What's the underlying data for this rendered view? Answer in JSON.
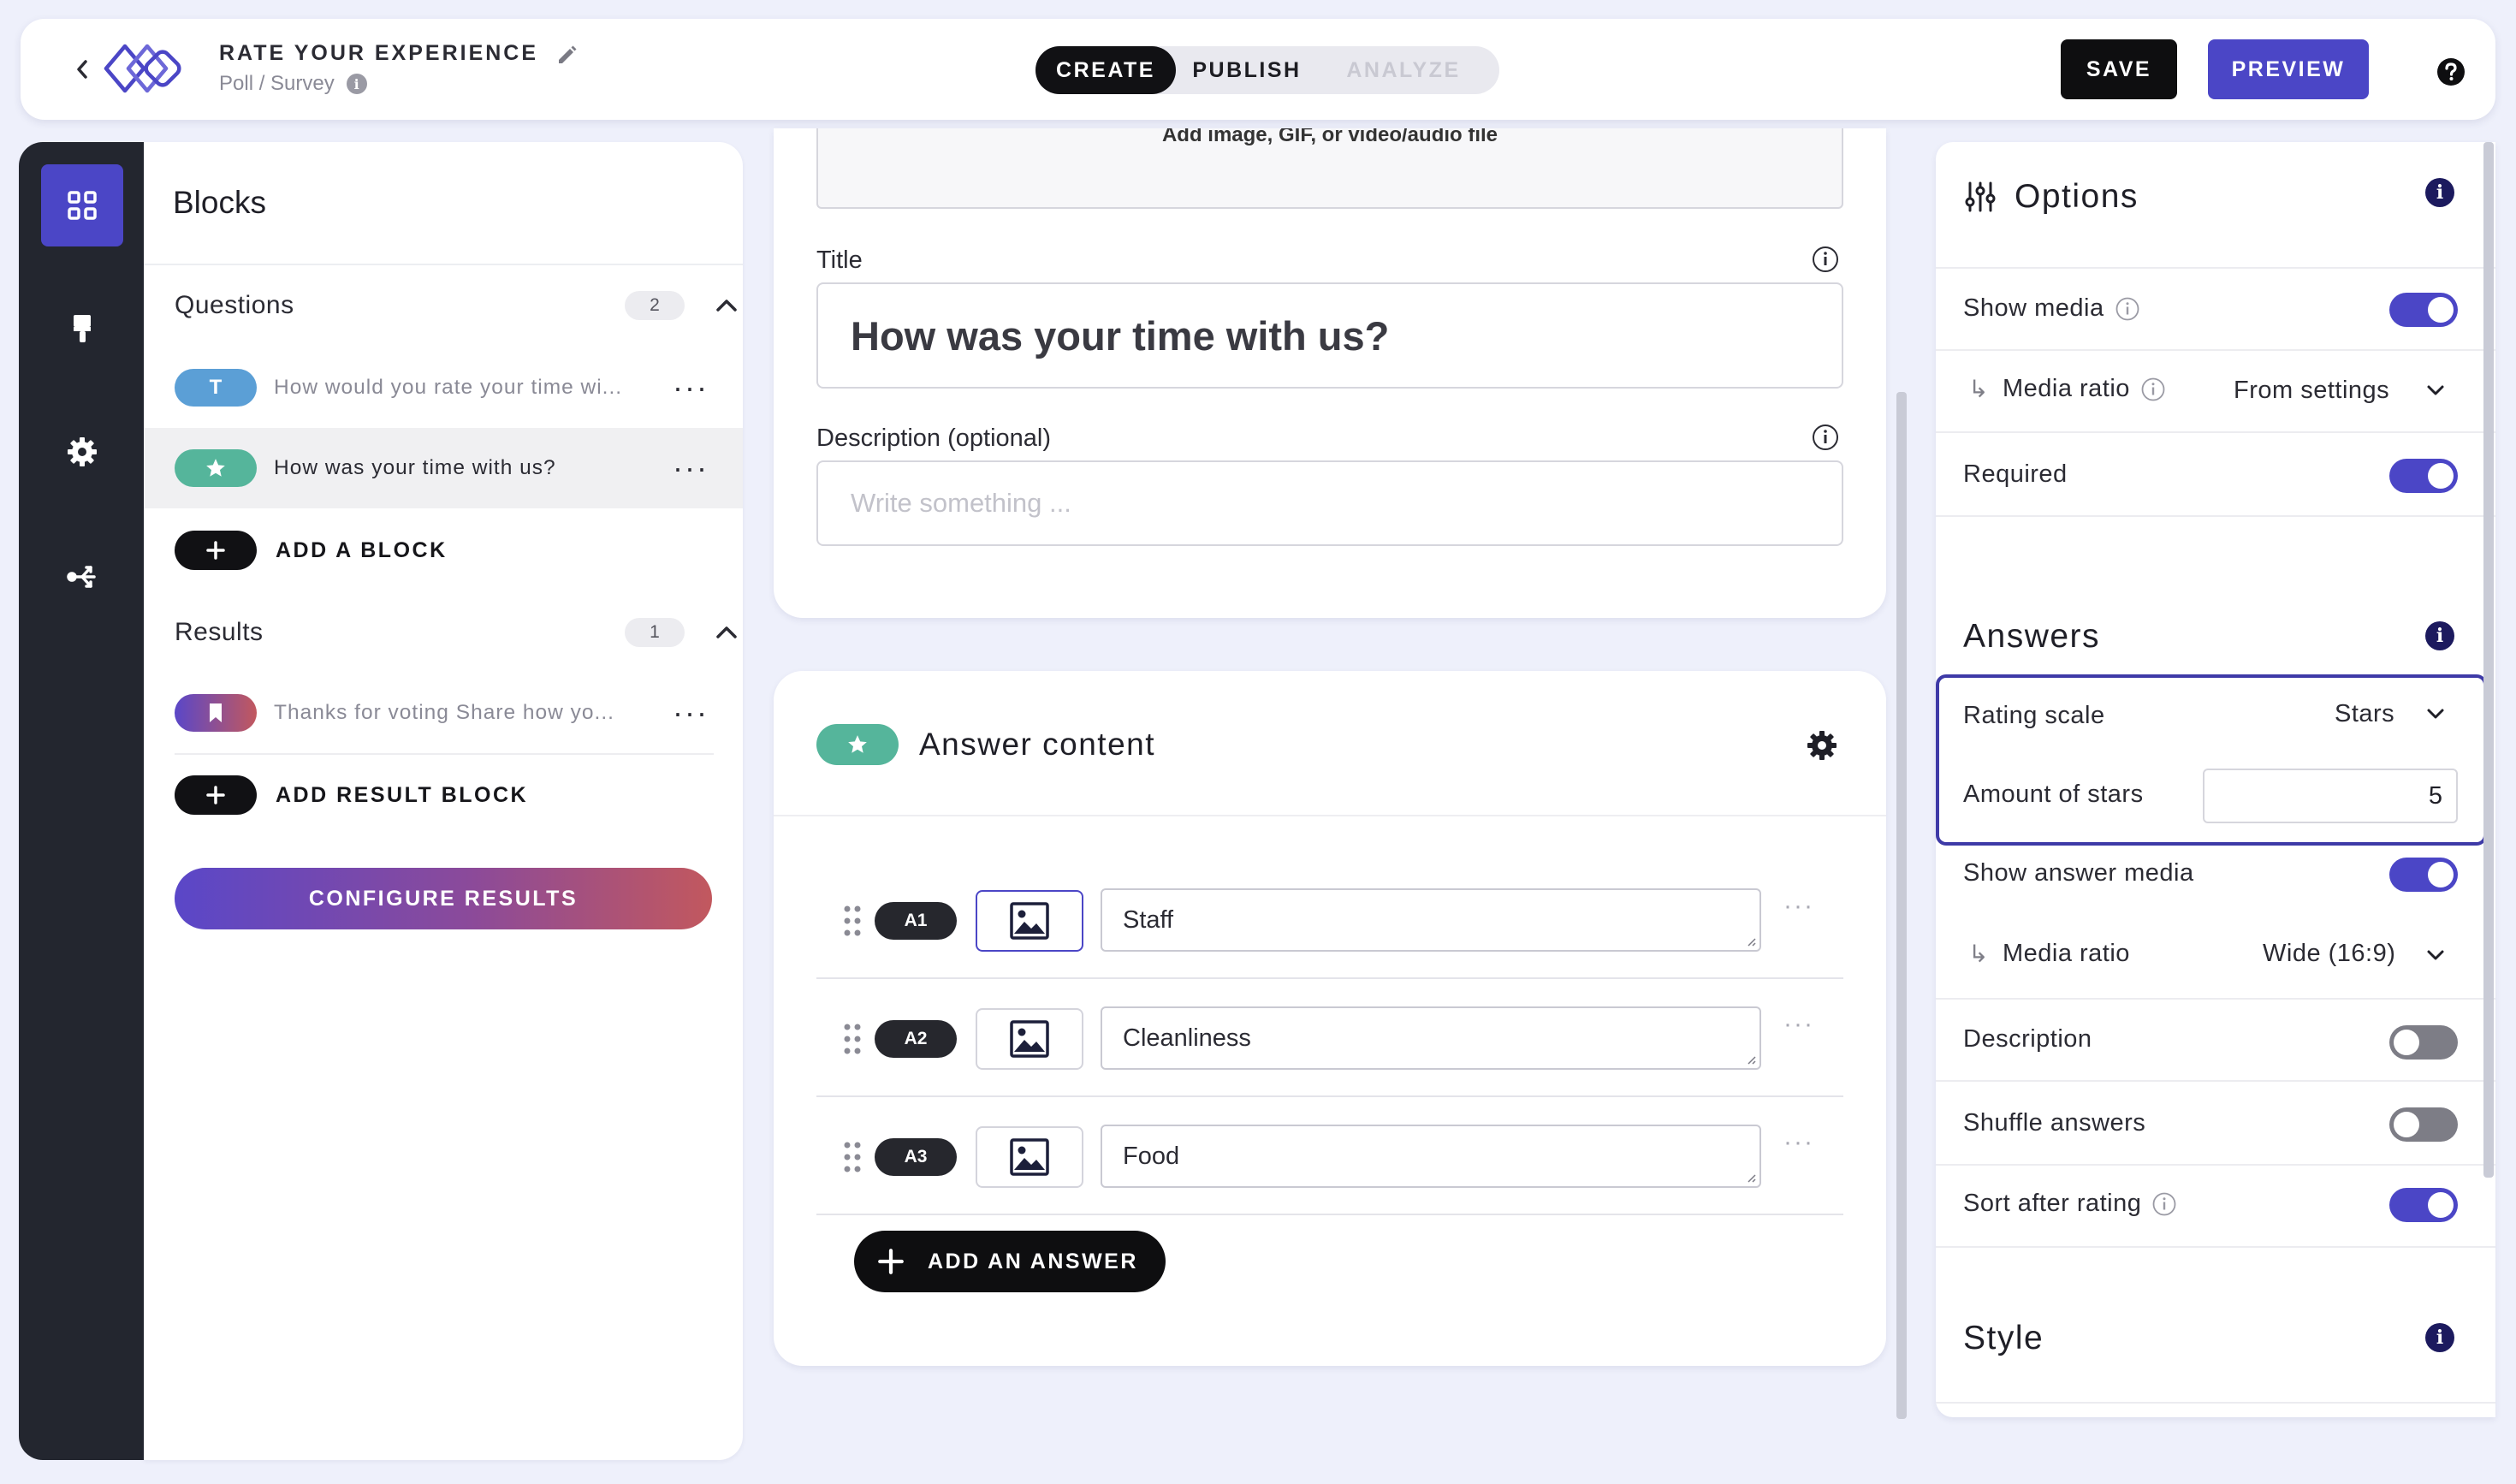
{
  "header": {
    "title": "RATE YOUR EXPERIENCE",
    "subtitle": "Poll / Survey",
    "modes": [
      "CREATE",
      "PUBLISH",
      "ANALYZE"
    ],
    "active_mode": "CREATE",
    "save_label": "SAVE",
    "preview_label": "PREVIEW",
    "icons": [
      "chevron-left-icon",
      "logo",
      "pencil-icon",
      "info-icon",
      "help-icon"
    ]
  },
  "rail": {
    "items": [
      "blocks-grid-icon",
      "paint-brush-icon",
      "gear-icon",
      "flow-icon"
    ],
    "active": "blocks-grid-icon"
  },
  "blocks": {
    "title": "Blocks",
    "questions_label": "Questions",
    "questions_count": "2",
    "questions": [
      {
        "chip": "T",
        "chip_color": "#5b9fd6",
        "text": "How would you rate your time wi..."
      },
      {
        "chip": "★",
        "chip_color": "#55b59b",
        "text": "How was your time with us?"
      }
    ],
    "add_block_label": "ADD A BLOCK",
    "results_label": "Results",
    "results_count": "1",
    "results": [
      {
        "text": "Thanks for voting Share how yo..."
      }
    ],
    "add_result_label": "ADD RESULT BLOCK",
    "configure_label": "CONFIGURE RESULTS"
  },
  "editor": {
    "media_hint": "Add image, GIF, or video/audio file",
    "title_label": "Title",
    "title_value": "How was your time with us?",
    "description_label": "Description (optional)",
    "description_placeholder": "Write something ...",
    "answers_title": "Answer content",
    "answers": [
      {
        "tag": "A1",
        "value": "Staff"
      },
      {
        "tag": "A2",
        "value": "Cleanliness"
      },
      {
        "tag": "A3",
        "value": "Food"
      }
    ],
    "add_answer_label": "ADD AN ANSWER"
  },
  "options": {
    "title": "Options",
    "show_media_label": "Show media",
    "show_media": true,
    "media_ratio_label": "Media ratio",
    "media_ratio_value": "From settings",
    "required_label": "Required",
    "required": true,
    "answers_title": "Answers",
    "rating_scale_label": "Rating scale",
    "rating_scale_value": "Stars",
    "amount_of_stars_label": "Amount of stars",
    "amount_of_stars_value": "5",
    "show_answer_media_label": "Show answer media",
    "show_answer_media": true,
    "answer_media_ratio_label": "Media ratio",
    "answer_media_ratio_value": "Wide (16:9)",
    "description_label": "Description",
    "description": false,
    "shuffle_label": "Shuffle answers",
    "shuffle": false,
    "sort_label": "Sort after rating",
    "sort": true,
    "style_title": "Style"
  },
  "colors": {
    "accent": "#4b46c6",
    "dark": "#0e0e10",
    "rail": "#23262f",
    "teal": "#55b59b",
    "blue_chip": "#5b9fd6",
    "background": "#eef0fb"
  }
}
